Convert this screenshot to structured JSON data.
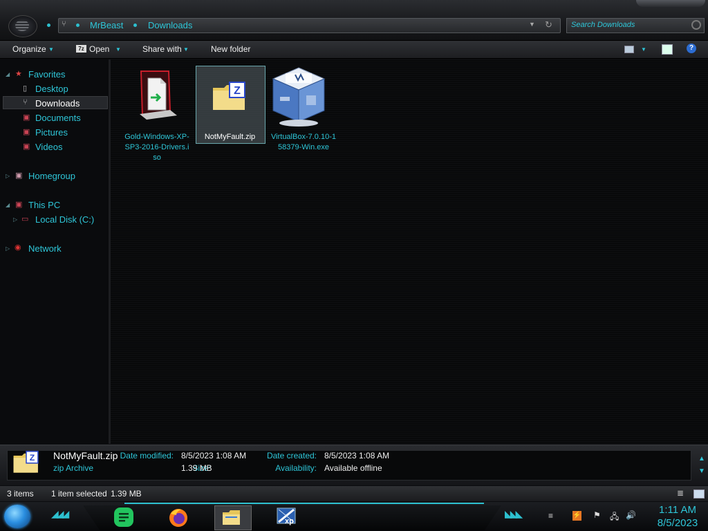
{
  "address": {
    "crumbs": [
      "MrBeast",
      "Downloads"
    ]
  },
  "search": {
    "placeholder": "Search Downloads"
  },
  "toolbar": {
    "organize": "Organize",
    "open": "Open",
    "open_icon_text": "7z",
    "share_with": "Share with",
    "new_folder": "New folder"
  },
  "nav": {
    "favorites": "Favorites",
    "desktop": "Desktop",
    "downloads": "Downloads",
    "documents": "Documents",
    "pictures": "Pictures",
    "videos": "Videos",
    "homegroup": "Homegroup",
    "this_pc": "This PC",
    "local_disk": "Local Disk (C:)",
    "network": "Network"
  },
  "files": [
    {
      "name": "Gold-Windows-XP-SP3-2016-Drivers.iso",
      "icon": "disc-image-icon"
    },
    {
      "name": "NotMyFault.zip",
      "icon": "zip-folder-icon",
      "selected": true
    },
    {
      "name": "VirtualBox-7.0.10-158379-Win.exe",
      "icon": "virtualbox-icon"
    }
  ],
  "details": {
    "name": "NotMyFault.zip",
    "type": "zip Archive",
    "date_modified_label": "Date modified:",
    "date_modified": "8/5/2023 1:08 AM",
    "size_label": "Size:",
    "size": "1.39 MB",
    "date_created_label": "Date created:",
    "date_created": "8/5/2023 1:08 AM",
    "availability_label": "Availability:",
    "availability": "Available offline"
  },
  "status": {
    "items": "3 items",
    "selected": "1 item selected",
    "size": "1.39 MB"
  },
  "taskbar": {
    "clock_time": "1:11 AM",
    "clock_date": "8/5/2023",
    "xp_label": "xp"
  },
  "colors": {
    "accent": "#2ec6d8",
    "background": "#0b0c0e"
  }
}
